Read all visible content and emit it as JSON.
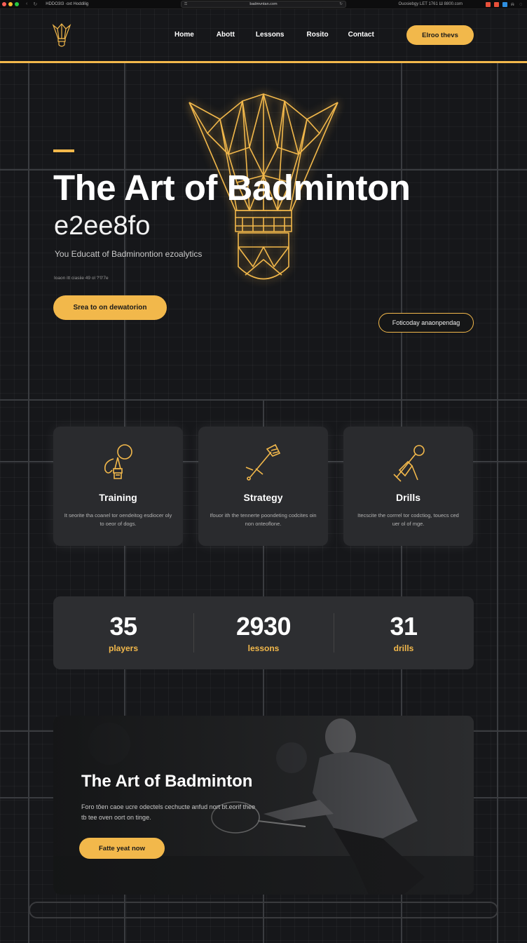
{
  "browser": {
    "tab_title": "HDDO3I3 ·oxt Hoddilig",
    "url": "badmvntan.com",
    "status_text": "Ouosiebgy LET 1761 Ш 8800.com",
    "traffic_colors": [
      "#ff5f57",
      "#febc2e",
      "#28c840"
    ],
    "tray_colors": [
      "#e8503a",
      "#e8503a",
      "#2f8fe0"
    ]
  },
  "header": {
    "logo_icon": "shuttlecock-icon",
    "nav": [
      "Home",
      "Abott",
      "Lessons",
      "Rosito",
      "Contact"
    ],
    "cta_label": "Elroo thevs"
  },
  "hero": {
    "title": "The Art of Badminton",
    "subtitle": "e2ee8fo",
    "tagline": "You Educatt of Badminontion ezoalytics",
    "meta": "Ioaon itt ciasiie 49 ol ?'0'7e",
    "primary_button": "Srea to on dewatorion",
    "secondary_button": "Foticoday anaonpendag"
  },
  "features": [
    {
      "icon": "shuttlecock-lightbulb-icon",
      "title": "Training",
      "description": "It seorite tha coanel tor oendeitog esdiocer oly to oeor of dogs."
    },
    {
      "icon": "racket-shuttle-icon",
      "title": "Strategy",
      "description": "Ifouor ith the tennerte poondeting codcites oin non onteoflone."
    },
    {
      "icon": "drill-racket-icon",
      "title": "Drills",
      "description": "Itecscite the corrrel tor codctiog, touecs ced uer ol of mge."
    }
  ],
  "stats": [
    {
      "value": "35",
      "label": "players"
    },
    {
      "value": "2930",
      "label": "lessons"
    },
    {
      "value": "31",
      "label": "drills"
    }
  ],
  "promo": {
    "title": "The Art of Badminton",
    "description": "Foro tôen caoe ucre odectels cechucte anfud nort bt.eorif thee tb tee oven oort on tinge.",
    "button": "Fatte yeat now"
  },
  "colors": {
    "accent": "#f2b84b",
    "background": "#151617",
    "card": "#2a2b2e"
  }
}
